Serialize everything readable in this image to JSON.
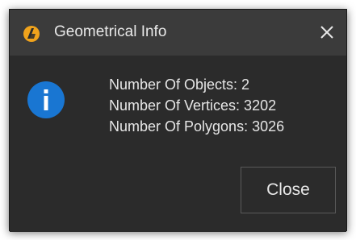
{
  "window": {
    "title": "Geometrical Info",
    "icons": {
      "app": "app-logo-icon",
      "close": "close-icon",
      "info": "info-icon"
    },
    "colors": {
      "titlebar": "#3b3b3b",
      "body": "#2b2b2b",
      "info_icon": "#1976d2",
      "logo": "#f0a31c",
      "text": "#e6e6e6"
    }
  },
  "message": {
    "lines": [
      "Number Of Objects: 2",
      "Number Of Vertices: 3202",
      "Number Of Polygons: 3026"
    ]
  },
  "buttons": {
    "close_label": "Close"
  }
}
